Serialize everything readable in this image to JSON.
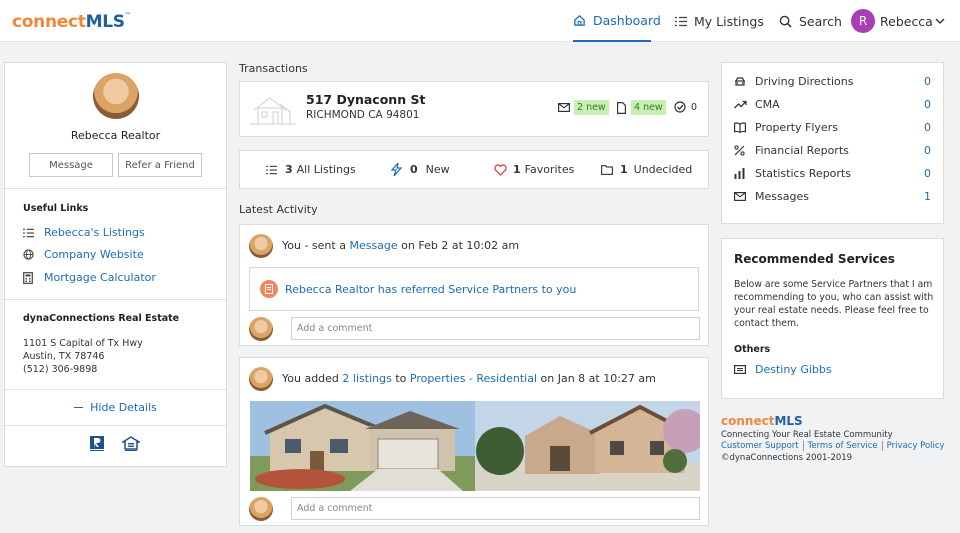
{
  "header": {
    "logo_part1": "connect",
    "logo_part2": "MLS",
    "logo_tm": "™",
    "nav": {
      "dashboard": "Dashboard",
      "my_listings": "My Listings",
      "search": "Search",
      "user_initial": "R",
      "user_name": "Rebecca"
    }
  },
  "profile": {
    "name": "Rebecca Realtor",
    "message_btn": "Message",
    "refer_btn": "Refer a Friend",
    "useful_links_title": "Useful Links",
    "links": [
      "Rebecca's Listings",
      "Company Website",
      "Mortgage Calculator"
    ],
    "company_title": "dynaConnections Real Estate",
    "address1": "1101 S Capital of Tx Hwy",
    "address2": "Austin, TX 78746",
    "phone": "(512) 306-9898",
    "hide_details": "Hide Details"
  },
  "transactions": {
    "title": "Transactions",
    "address_line1": "517 Dynaconn St",
    "address_line2": "RICHMOND CA 94801",
    "messages_new": "2 new",
    "docs_new": "4 new",
    "tasks_count": "0"
  },
  "listing_summary": {
    "all_count": "3",
    "all_label": "All Listings",
    "new_count": "0",
    "new_label": "New",
    "fav_count": "1",
    "fav_label": "Favorites",
    "undecided_count": "1",
    "undecided_label": "Undecided"
  },
  "activity": {
    "title": "Latest Activity",
    "item1": {
      "prefix": "You - sent a ",
      "link": "Message",
      "suffix": " on Feb 2 at 10:02 am",
      "referral_text": "Rebecca Realtor has referred Service Partners to you",
      "comment_placeholder": "Add a comment"
    },
    "item2": {
      "prefix": "You added ",
      "link1": "2 listings",
      "mid": " to ",
      "link2": "Properties - Residential",
      "suffix": " on Jan 8 at 10:27 am",
      "comment_placeholder": "Add a comment"
    }
  },
  "stats": [
    {
      "label": "Driving Directions",
      "count": "0"
    },
    {
      "label": "CMA",
      "count": "0"
    },
    {
      "label": "Property Flyers",
      "count": "0"
    },
    {
      "label": "Financial Reports",
      "count": "0"
    },
    {
      "label": "Statistics Reports",
      "count": "0"
    },
    {
      "label": "Messages",
      "count": "1"
    }
  ],
  "recommended": {
    "title": "Recommended Services",
    "description": "Below are some Service Partners that I am recommending to you, who can assist with your real estate needs. Please feel free to contact them.",
    "others_label": "Others",
    "partner": "Destiny Gibbs"
  },
  "footer": {
    "logo_part1": "connect",
    "logo_part2": "MLS",
    "tagline": "Connecting Your Real Estate Community",
    "support": "Customer Support",
    "terms": "Terms of Service",
    "privacy": "Privacy Policy",
    "copyright": "©dynaConnections 2001-2019"
  },
  "colors": {
    "accent": "#1f6bb4",
    "logo_orange": "#f0883a",
    "badge_green": "#c8f0b0",
    "avatar_purple": "#a93fb5"
  }
}
